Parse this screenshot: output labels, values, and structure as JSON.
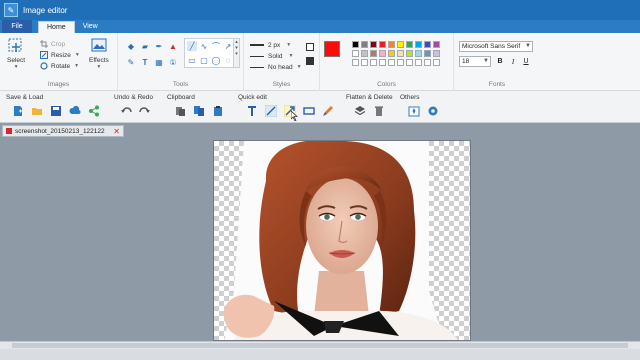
{
  "window": {
    "title": "Image editor"
  },
  "menu": {
    "file": "File",
    "tabs": [
      "Home",
      "View"
    ]
  },
  "ribbon": {
    "images": {
      "label": "Images",
      "select": "Select",
      "crop": "Crop",
      "resize": "Resize",
      "rotate": "Rotate",
      "effects": "Effects"
    },
    "tools": {
      "label": "Tools"
    },
    "styles": {
      "label": "Styles",
      "width": "2 px",
      "line": "Solid",
      "head": "No head"
    },
    "colors": {
      "label": "Colors",
      "primary": "#ff0a0a",
      "palette": [
        "#000000",
        "#7f7f7f",
        "#880015",
        "#ed1c24",
        "#ff7f27",
        "#fff200",
        "#22b14c",
        "#00a2e8",
        "#3f48cc",
        "#a349a4",
        "#ffffff",
        "#c3c3c3",
        "#b97a57",
        "#ffaec9",
        "#ffc90e",
        "#efe4b0",
        "#b5e61d",
        "#99d9ea",
        "#7092be",
        "#c8bfe7",
        "#ffffff",
        "#ffffff",
        "#ffffff",
        "#ffffff",
        "#ffffff",
        "#ffffff",
        "#ffffff",
        "#ffffff",
        "#ffffff",
        "#ffffff"
      ]
    },
    "fonts": {
      "label": "Fonts",
      "family": "Microsoft Sans Serif",
      "size": "18",
      "bold": "B",
      "italic": "I",
      "underline": "U"
    }
  },
  "toolbar": {
    "save_load": "Save & Load",
    "undo_redo": "Undo & Redo",
    "clipboard": "Clipboard",
    "quick_edit": "Quick edit",
    "flatten_delete": "Flatten & Delete",
    "others": "Others"
  },
  "document": {
    "tab_name": "screenshot_20150213_122122",
    "close": "✕"
  }
}
